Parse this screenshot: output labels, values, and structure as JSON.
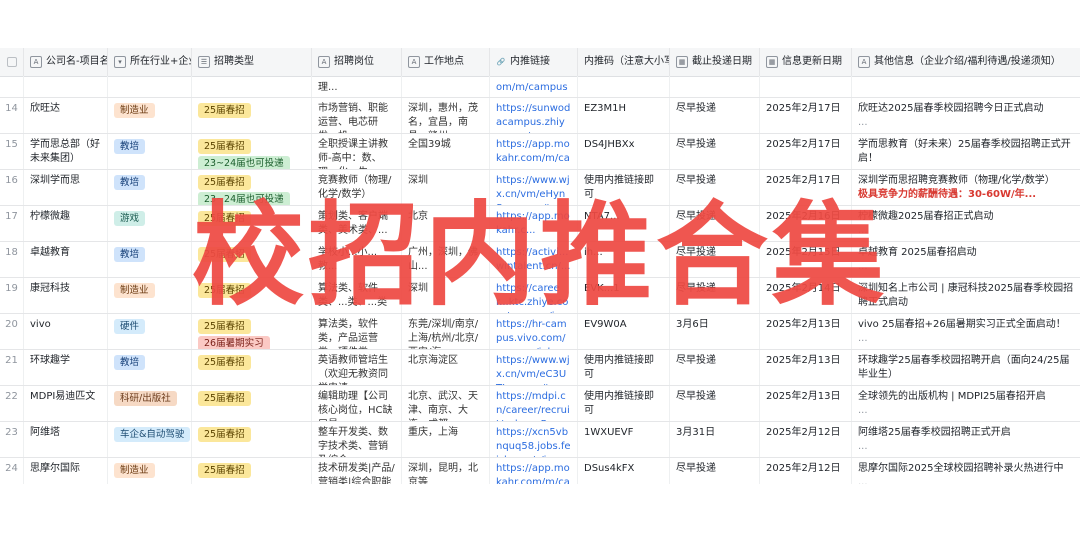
{
  "columns": [
    {
      "icon": "text-icon",
      "label": "公司名-项目名"
    },
    {
      "icon": "select-icon",
      "label": "所在行业+企业类型"
    },
    {
      "icon": "select-icon",
      "label": "招聘类型"
    },
    {
      "icon": "text-icon",
      "label": "招聘岗位"
    },
    {
      "icon": "text-icon",
      "label": "工作地点"
    },
    {
      "icon": "link-icon",
      "label": "内推链接"
    },
    {
      "icon": "",
      "label": "内推码（注意大小写）"
    },
    {
      "icon": "calendar-icon",
      "label": "截止投递日期"
    },
    {
      "icon": "calendar-icon",
      "label": "信息更新日期"
    },
    {
      "icon": "text-icon",
      "label": "其他信息（企业介绍/福利待遇/投递须知）"
    }
  ],
  "partial_row": {
    "positions": "理...",
    "link": "om/m/campus-recr..."
  },
  "rows": [
    {
      "num": "14",
      "company": "欣旺达",
      "industry": [
        {
          "t": "制造业",
          "c": "orange"
        }
      ],
      "types": [
        {
          "t": "25届春招",
          "c": "yellow"
        }
      ],
      "positions": "市场营销、职能运营、电芯研发、机...",
      "location": "深圳，惠州，茂名，宜昌，南昌，赣州...",
      "link": "https://sunwodacampus.zhiye.com/ca...",
      "code": "EZ3M1H",
      "deadline": "尽早投递",
      "updated": "2025年2月17日",
      "info": "欣旺达2025届春季校园招聘今日正式启动",
      "info2": "..."
    },
    {
      "num": "15",
      "company": "学而思总部（好未来集团）",
      "industry": [
        {
          "t": "教培",
          "c": "blue"
        }
      ],
      "types": [
        {
          "t": "25届春招",
          "c": "yellow"
        },
        {
          "t": "23~24届也可投递",
          "c": "green"
        }
      ],
      "positions": "全职授课主讲教师-高中：数、理、化、生...",
      "location": "全国39城",
      "link": "https://app.mokahr.com/m/campus-recr...",
      "code": "DS4JHBXx",
      "deadline": "尽早投递",
      "updated": "2025年2月17日",
      "info": "学而思教育（好未来）25届春季校园招聘正式开启！",
      "info2": "..."
    },
    {
      "num": "16",
      "company": "深圳学而思",
      "industry": [
        {
          "t": "教培",
          "c": "blue"
        }
      ],
      "types": [
        {
          "t": "25届春招",
          "c": "yellow"
        },
        {
          "t": "23~24届也可投递",
          "c": "green"
        }
      ],
      "positions": "竞赛教师（物理/化学/数学）",
      "location": "深圳",
      "link": "https://www.wjx.cn/vm/eHynSqp.aspx#",
      "code": "使用内推链接即可",
      "deadline": "尽早投递",
      "updated": "2025年2月17日",
      "info": "深圳学而思招聘竞赛教师（物理/化学/数学）",
      "info_red": "极具竞争力的薪酬待遇：30-60W/年...",
      "info2": ""
    },
    {
      "num": "17",
      "company": "柠檬微趣",
      "industry": [
        {
          "t": "游戏",
          "c": "teal"
        }
      ],
      "types": [
        {
          "t": "25届春招",
          "c": "yellow"
        }
      ],
      "positions": "策划类、客户端类、美术类、...",
      "location": "北京",
      "link": "https://app.mokahr.c...",
      "code": "NTA7...",
      "deadline": "尽早投递",
      "updated": "2025年2月16日",
      "info": "柠檬微趣2025届春招正式启动",
      "info2": "..."
    },
    {
      "num": "18",
      "company": "卓越教育",
      "industry": [
        {
          "t": "教培",
          "c": "blue"
        }
      ],
      "types": [
        {
          "t": "25届春招",
          "c": "yellow"
        }
      ],
      "positions": "学校小...小...教...",
      "location": "广州，深圳，佛山...",
      "link": "https://activi...wintalent.cn/...",
      "code": "ih...",
      "deadline": "尽早投递",
      "updated": "2025年2月15日",
      "info": "卓越教育 2025届春招启动",
      "info2": "..."
    },
    {
      "num": "19",
      "company": "康冠科技",
      "industry": [
        {
          "t": "制造业",
          "c": "orange"
        }
      ],
      "types": [
        {
          "t": "25届春招",
          "c": "yellow"
        }
      ],
      "positions": "算法类、软件类、...类、...类",
      "location": "深圳",
      "link": "https://career...ktc.zhiye.com/campus/jo...",
      "code": "EVK...1",
      "deadline": "尽早投递",
      "updated": "2025年2月14日",
      "info": "深圳知名上市公司 | 康冠科技2025届春季校园招聘正式启动",
      "info2": "..."
    },
    {
      "num": "20",
      "company": "vivo",
      "industry": [
        {
          "t": "硬件",
          "c": "sky"
        }
      ],
      "types": [
        {
          "t": "25届春招",
          "c": "yellow"
        },
        {
          "t": "26届暑期实习",
          "c": "pink"
        }
      ],
      "positions": "算法类，软件类，产品运营类，硬件类...",
      "location": "东莞/深圳/南京/上海/杭州/北京/西安/海...",
      "link": "https://hr-campus.vivo.com/campus/job...",
      "code": "EV9W0A",
      "deadline": "3月6日",
      "updated": "2025年2月13日",
      "info": "vivo 25届春招+26届暑期实习正式全面启动！",
      "info2": "..."
    },
    {
      "num": "21",
      "company": "环球趣学",
      "industry": [
        {
          "t": "教培",
          "c": "blue"
        }
      ],
      "types": [
        {
          "t": "25届春招",
          "c": "yellow"
        }
      ],
      "positions": "英语教师管培生（欢迎无教资同学申请...",
      "location": "北京海淀区",
      "link": "https://www.wjx.cn/vm/eC3UTLn.aspx#",
      "code": "使用内推链接即可",
      "deadline": "尽早投递",
      "updated": "2025年2月13日",
      "info": "环球趣学25届春季校园招聘开启（面向24/25届毕业生）",
      "info2": "..."
    },
    {
      "num": "22",
      "company": "MDPI易迪匹文",
      "industry": [
        {
          "t": "科研/出版社",
          "c": "brown"
        }
      ],
      "types": [
        {
          "t": "25届春招",
          "c": "yellow"
        }
      ],
      "positions": "编辑助理【公司核心岗位，HC缺口最...",
      "location": "北京、武汉、天津、南京、大连、成都",
      "link": "https://mdpi.cn/career/recruit/calnnerRe...",
      "code": "使用内推链接即可",
      "deadline": "尽早投递",
      "updated": "2025年2月13日",
      "info": "全球领先的出版机构 | MDPI25届春招开启",
      "info2": "..."
    },
    {
      "num": "23",
      "company": "阿维塔",
      "industry": [
        {
          "t": "车企&自动驾驶",
          "c": "sky"
        }
      ],
      "types": [
        {
          "t": "25届春招",
          "c": "yellow"
        }
      ],
      "positions": "整车开发类、数字技术类、营销及综合",
      "location": "重庆，上海",
      "link": "https://xcn5vbnquq58.jobs.feishu.cn/s/i...",
      "code": "1WXUEVF",
      "deadline": "3月31日",
      "updated": "2025年2月12日",
      "info": "阿维塔25届春季校园招聘正式开启",
      "info2": "..."
    },
    {
      "num": "24",
      "company": "思摩尔国际",
      "industry": [
        {
          "t": "制造业",
          "c": "orange"
        }
      ],
      "types": [
        {
          "t": "25届春招",
          "c": "yellow"
        }
      ],
      "positions": "技术研发类|产品/营销类|综合职能类|...",
      "location": "深圳，昆明，北京等",
      "link": "https://app.mokahr.com/m/campus_ap...",
      "code": "DSus4kFX",
      "deadline": "尽早投递",
      "updated": "2025年2月12日",
      "info": "思摩尔国际2025全球校园招聘补录火热进行中",
      "info2": "..."
    }
  ],
  "overlay_title": "校招内推合集"
}
